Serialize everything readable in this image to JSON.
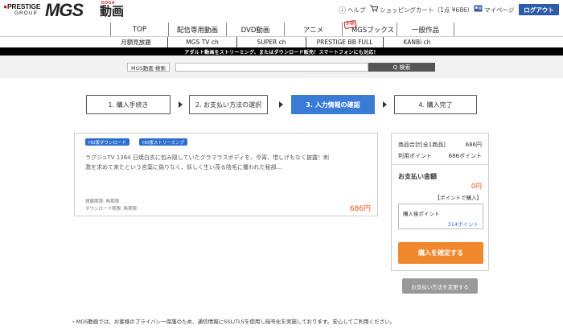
{
  "header": {
    "logo_prestige_line1": "PRESTIGE",
    "logo_prestige_line2": "GROUP",
    "logo_mgs": "MGS",
    "logo_doga": "DOGA",
    "logo_kanji": "動画",
    "help_label": "ヘルプ",
    "cart_label": "ショッピングカート（1点 ¥686）",
    "mypage_label": "マイページ",
    "logout_label": "ログアウト"
  },
  "nav_main": [
    {
      "label": "TOP"
    },
    {
      "label": "配信専用動画"
    },
    {
      "label": "DVD動画"
    },
    {
      "label": "アニメ"
    },
    {
      "label": "MGSブックス",
      "badge": "半額"
    },
    {
      "label": "一般作品"
    }
  ],
  "nav_sub": [
    {
      "label": "月額見放題"
    },
    {
      "label": "MGS TV ch"
    },
    {
      "label": "SUPER ch"
    },
    {
      "label": "PRESTIGE BB FULL"
    },
    {
      "label": "KANBi ch"
    }
  ],
  "notice": "アダルト動画をストリーミング、またはダウンロード販売！スマートフォンにも対応！",
  "search": {
    "label": "MGS動画 検索",
    "value": "",
    "placeholder": "",
    "button": "Q 検索"
  },
  "steps": [
    {
      "label": "1. 購入手続き",
      "active": false
    },
    {
      "label": "2. お支払い方法の選択",
      "active": false
    },
    {
      "label": "3. 入力情報の確認",
      "active": true
    },
    {
      "label": "4. 購入完了",
      "active": false
    }
  ],
  "product": {
    "tags": [
      "HD版ダウンロード",
      "HD版ストリーミング"
    ],
    "description": "ラグジュTV 1364 日焼白衣に包み隠していたグラマラスボディを、今宵、惜しげもなく披露！刺激を求めて来たという言葉に偽りなく、妖しく生い茂る陰毛に覆われた秘部...",
    "view_period": "視聴期限: 無期限",
    "download_period": "ダウンロード期限: 無期限",
    "price": "686円"
  },
  "summary": {
    "total_label": "商品合計[全1商品]",
    "total_value": "686円",
    "points_label": "利用ポイント",
    "points_value": "686ポイント",
    "payment_label": "お支払い金額",
    "payment_amount": "0円",
    "payment_note": "【ポイントで購入】",
    "after_label": "購入後ポイント",
    "after_value": "314ポイント",
    "confirm_button": "購入を確定する"
  },
  "change_payment_button": "お支払い方法を変更する",
  "footnote": "・MGS動画では、お客様のプライバシー保護のため、通信情報にSSL/TLSを使用し暗号化を実施しております。安心してご利用ください。",
  "colors": {
    "accent_blue": "#3a7bd5",
    "logout_blue": "#2d5ba8",
    "orange": "#f0892d",
    "price_orange": "#e0531a"
  }
}
